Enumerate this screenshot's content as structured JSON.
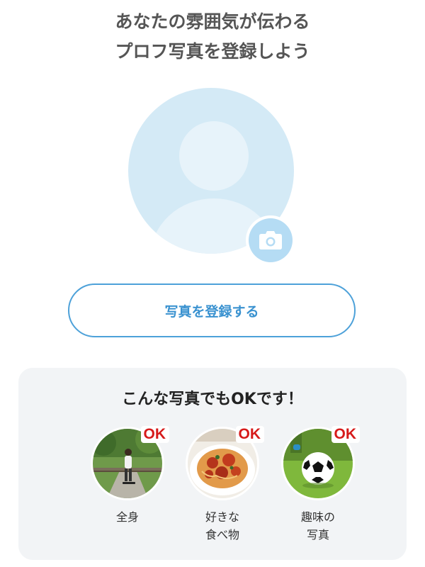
{
  "header": {
    "title_line1": "あなたの雰囲気が伝わる",
    "title_line2": "プロフ写真を登録しよう"
  },
  "avatar": {
    "placeholder_icon": "user-silhouette-icon",
    "camera_icon": "camera-icon"
  },
  "actions": {
    "register_label": "写真を登録する"
  },
  "ok_examples": {
    "title": "こんな写真でもOKです！",
    "items": [
      {
        "badge": "OK",
        "caption_line1": "全身",
        "caption_line2": "",
        "icon": "person-walking-photo"
      },
      {
        "badge": "OK",
        "caption_line1": "好きな",
        "caption_line2": "食べ物",
        "icon": "pasta-photo"
      },
      {
        "badge": "OK",
        "caption_line1": "趣味の",
        "caption_line2": "写真",
        "icon": "soccer-ball-photo"
      }
    ]
  },
  "colors": {
    "accent": "#3a92d0",
    "avatar_bg": "#d4eaf6",
    "ok_red": "#d61a1a",
    "panel_bg": "#f2f4f6"
  }
}
